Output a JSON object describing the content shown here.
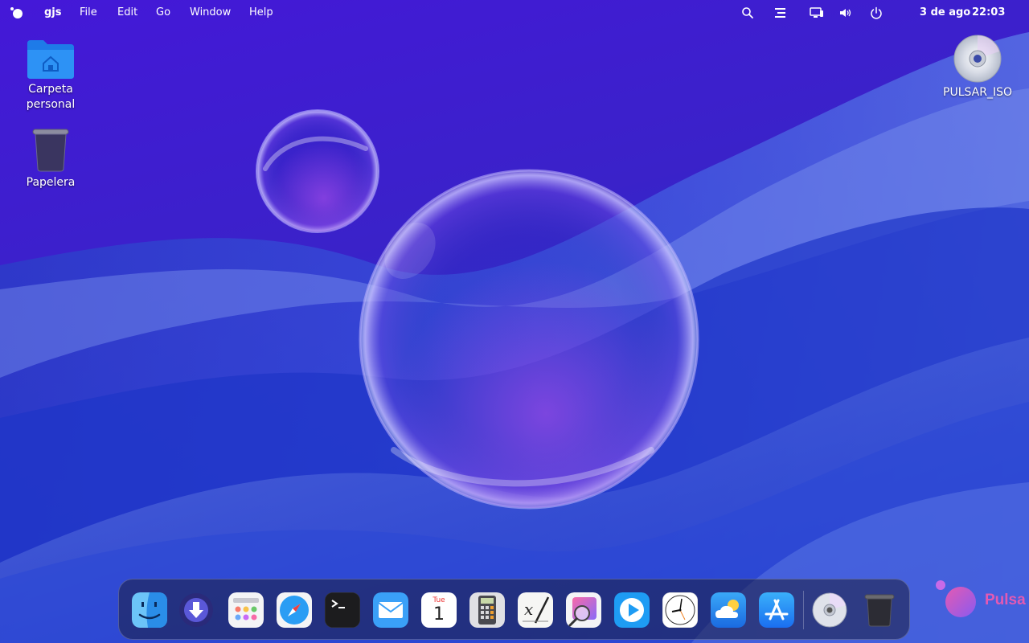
{
  "topbar": {
    "app_name": "gjs",
    "menus": [
      "File",
      "Edit",
      "Go",
      "Window",
      "Help"
    ],
    "tray_icons": [
      "search-icon",
      "notifications-icon",
      "display-icon",
      "volume-icon",
      "power-icon"
    ],
    "date": "3 de ago",
    "time": "22:03"
  },
  "desktop": {
    "home_folder": {
      "label_line1": "Carpeta",
      "label_line2": "personal",
      "icon": "home-folder-icon"
    },
    "trash": {
      "label": "Papelera",
      "icon": "trash-icon"
    },
    "disc": {
      "label": "PULSAR_ISO",
      "icon": "optical-disc-icon"
    }
  },
  "dock": {
    "items": [
      {
        "name": "finder",
        "icon": "finder-icon"
      },
      {
        "name": "downloader",
        "icon": "download-icon"
      },
      {
        "name": "launchpad",
        "icon": "app-grid-icon"
      },
      {
        "name": "safari",
        "icon": "compass-icon"
      },
      {
        "name": "terminal",
        "icon": "terminal-icon"
      },
      {
        "name": "mail",
        "icon": "mail-icon"
      },
      {
        "name": "calendar",
        "icon": "calendar-icon",
        "weekday": "Tue",
        "day": "1"
      },
      {
        "name": "calculator",
        "icon": "calculator-icon"
      },
      {
        "name": "text-editor",
        "icon": "text-editor-icon"
      },
      {
        "name": "image-viewer",
        "icon": "image-viewer-icon"
      },
      {
        "name": "media-player",
        "icon": "play-icon"
      },
      {
        "name": "clock",
        "icon": "clock-icon"
      },
      {
        "name": "weather",
        "icon": "weather-icon"
      },
      {
        "name": "app-store",
        "icon": "app-store-icon"
      },
      {
        "name": "disc",
        "icon": "optical-disc-icon"
      },
      {
        "name": "trash",
        "icon": "trash-icon"
      }
    ]
  },
  "brand": {
    "text": "Pulsa"
  },
  "colors": {
    "accent": "#e45ab2",
    "wallpaper_top": "#3a1fd0",
    "wallpaper_bottom": "#1630c8"
  }
}
